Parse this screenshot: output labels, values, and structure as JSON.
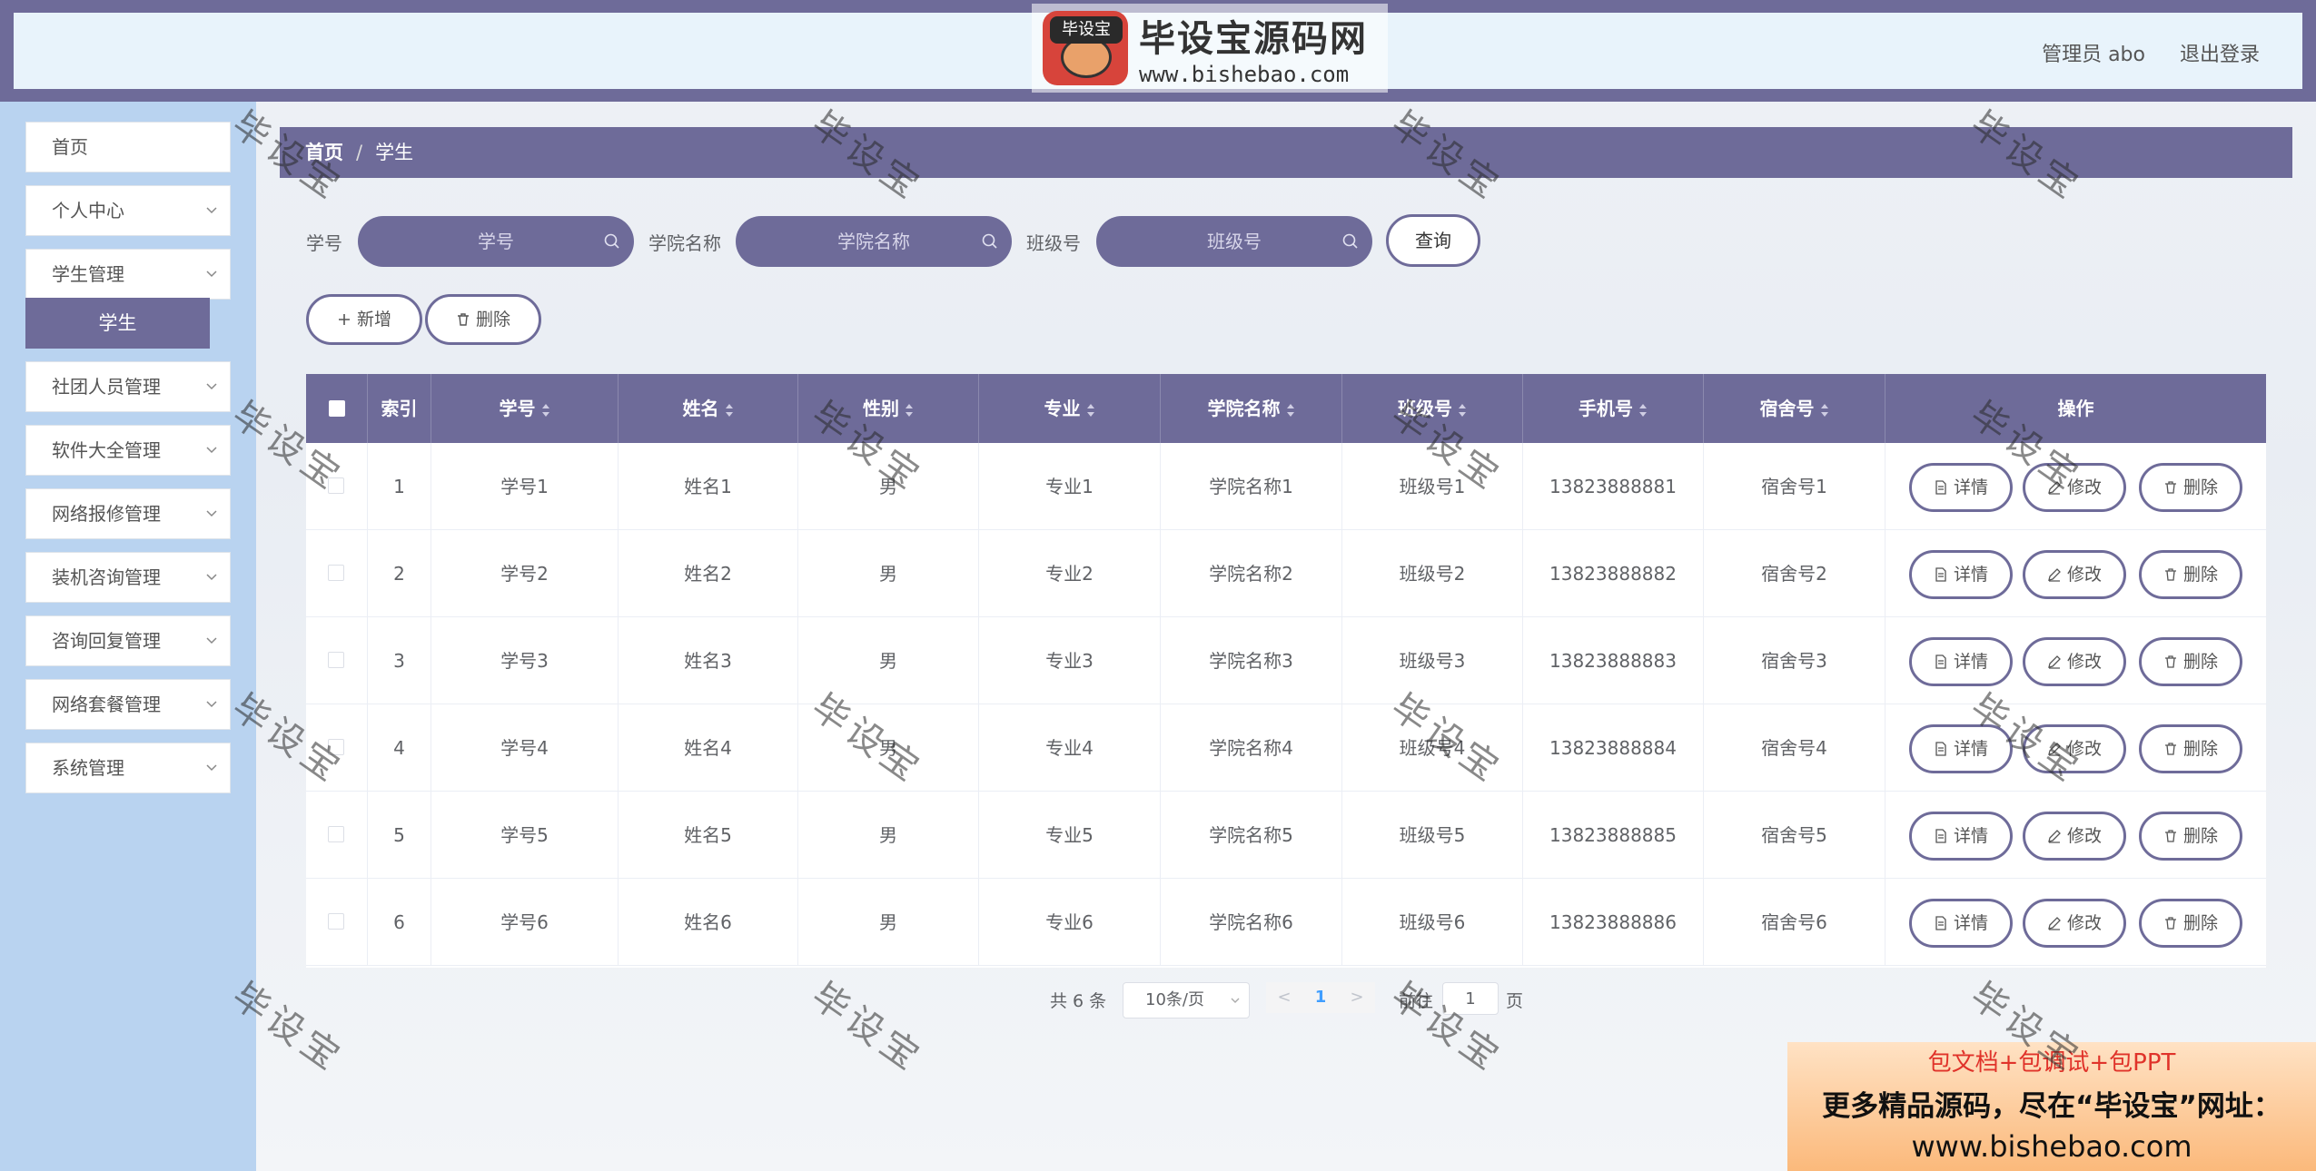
{
  "header": {
    "user_label": "管理员 abo",
    "logout_label": "退出登录",
    "brand": {
      "badge": "毕设宝",
      "title": "毕设宝源码网",
      "url": "www.bishebao.com"
    }
  },
  "sidebar": {
    "items": [
      {
        "label": "首页"
      },
      {
        "label": "个人中心"
      },
      {
        "label": "学生管理"
      },
      {
        "label": "社团人员管理"
      },
      {
        "label": "软件大全管理"
      },
      {
        "label": "网络报修管理"
      },
      {
        "label": "装机咨询管理"
      },
      {
        "label": "咨询回复管理"
      },
      {
        "label": "网络套餐管理"
      },
      {
        "label": "系统管理"
      }
    ],
    "active_sub": "学生"
  },
  "breadcrumb": {
    "home": "首页",
    "separator": "/",
    "current": "学生"
  },
  "search": {
    "fields": [
      {
        "label": "学号",
        "placeholder": "学号"
      },
      {
        "label": "学院名称",
        "placeholder": "学院名称"
      },
      {
        "label": "班级号",
        "placeholder": "班级号"
      }
    ],
    "query_label": "查询"
  },
  "actions": {
    "add_label": "新增",
    "delete_label": "删除"
  },
  "table": {
    "columns": [
      "索引",
      "学号",
      "姓名",
      "性别",
      "专业",
      "学院名称",
      "班级号",
      "手机号",
      "宿舍号",
      "操作"
    ],
    "rows": [
      {
        "index": "1",
        "id": "学号1",
        "name": "姓名1",
        "gender": "男",
        "major": "专业1",
        "college": "学院名称1",
        "class": "班级号1",
        "phone": "13823888881",
        "dorm": "宿舍号1"
      },
      {
        "index": "2",
        "id": "学号2",
        "name": "姓名2",
        "gender": "男",
        "major": "专业2",
        "college": "学院名称2",
        "class": "班级号2",
        "phone": "13823888882",
        "dorm": "宿舍号2"
      },
      {
        "index": "3",
        "id": "学号3",
        "name": "姓名3",
        "gender": "男",
        "major": "专业3",
        "college": "学院名称3",
        "class": "班级号3",
        "phone": "13823888883",
        "dorm": "宿舍号3"
      },
      {
        "index": "4",
        "id": "学号4",
        "name": "姓名4",
        "gender": "男",
        "major": "专业4",
        "college": "学院名称4",
        "class": "班级号4",
        "phone": "13823888884",
        "dorm": "宿舍号4"
      },
      {
        "index": "5",
        "id": "学号5",
        "name": "姓名5",
        "gender": "男",
        "major": "专业5",
        "college": "学院名称5",
        "class": "班级号5",
        "phone": "13823888885",
        "dorm": "宿舍号5"
      },
      {
        "index": "6",
        "id": "学号6",
        "name": "姓名6",
        "gender": "男",
        "major": "专业6",
        "college": "学院名称6",
        "class": "班级号6",
        "phone": "13823888886",
        "dorm": "宿舍号6"
      }
    ],
    "row_actions": {
      "detail": "详情",
      "edit": "修改",
      "delete": "删除"
    }
  },
  "pagination": {
    "total": "共 6 条",
    "page_size": "10条/页",
    "prev": "<",
    "current_page": "1",
    "next": ">",
    "goto_prefix": "前往",
    "goto_value": "1",
    "goto_suffix": "页"
  },
  "ad": {
    "line1": "包文档+包调试+包PPT",
    "line2": "更多精品源码，尽在“毕设宝”网址：",
    "line3": "www.bishebao.com"
  },
  "watermark_text": "毕设宝",
  "colors": {
    "primary": "#6e6b99",
    "sidebar": "#b9d3f0",
    "header_inner": "#e8f3fb"
  }
}
